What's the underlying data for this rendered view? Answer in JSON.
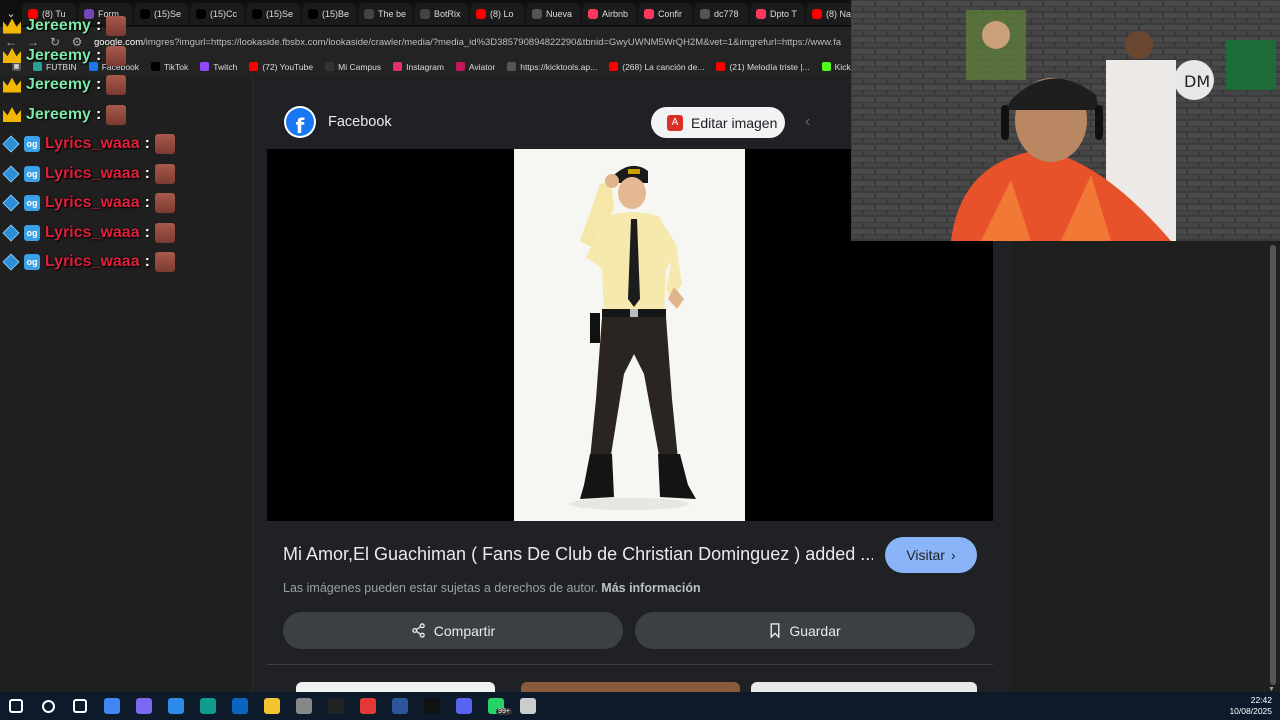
{
  "tabs": [
    {
      "label": "(8) Tu",
      "icon": "youtube-icon",
      "color": "#ff0000"
    },
    {
      "label": "Form",
      "icon": "forms-icon",
      "color": "#7248b9"
    },
    {
      "label": "(15)Se",
      "icon": "tiktok-icon",
      "color": "#000000"
    },
    {
      "label": "(15)Cc",
      "icon": "tiktok-icon",
      "color": "#000000"
    },
    {
      "label": "(15)Se",
      "icon": "tiktok-icon",
      "color": "#000000"
    },
    {
      "label": "(15)Be",
      "icon": "tiktok-icon",
      "color": "#000000"
    },
    {
      "label": "The be",
      "icon": "shield-icon",
      "color": "#444444"
    },
    {
      "label": "BotRix",
      "icon": "shield-icon",
      "color": "#444444"
    },
    {
      "label": "(8) Lo",
      "icon": "youtube-icon",
      "color": "#ff0000"
    },
    {
      "label": "Nueva",
      "icon": "openai-icon",
      "color": "#555555"
    },
    {
      "label": "Airbnb",
      "icon": "airbnb-icon",
      "color": "#ff385c"
    },
    {
      "label": "Confir",
      "icon": "airbnb-icon",
      "color": "#ff385c"
    },
    {
      "label": "dc778",
      "icon": "loading-icon",
      "color": "#555555"
    },
    {
      "label": "Dpto T",
      "icon": "airbnb-icon",
      "color": "#ff385c"
    },
    {
      "label": "(8) Na",
      "icon": "youtube-icon",
      "color": "#ff0000"
    }
  ],
  "url": {
    "domain": "google.com",
    "rest": "/imgres?imgurl=https://lookaside.fbsbx.com/lookaside/crawler/media/?media_id%3D385790894822290&tbnid=GwyUWNM5WrQH2M&vet=1&imgrefurl=https://www.fa"
  },
  "bookmarks": [
    {
      "label": "FUTBIN",
      "icon": "futbin-icon",
      "color": "#2aa198"
    },
    {
      "label": "Facebook",
      "icon": "facebook-icon",
      "color": "#1877f2"
    },
    {
      "label": "TikTok",
      "icon": "tiktok-icon",
      "color": "#000000"
    },
    {
      "label": "Twitch",
      "icon": "twitch-icon",
      "color": "#9146ff"
    },
    {
      "label": "(72) YouTube",
      "icon": "youtube-icon",
      "color": "#ff0000"
    },
    {
      "label": "Mi Campus",
      "icon": "campus-icon",
      "color": "#333333"
    },
    {
      "label": "Instagram",
      "icon": "instagram-icon",
      "color": "#e1306c"
    },
    {
      "label": "Aviator",
      "icon": "aviator-icon",
      "color": "#c2185b"
    },
    {
      "label": "https://kicktools.ap...",
      "icon": "globe-icon",
      "color": "#555555"
    },
    {
      "label": "(268) La canción de...",
      "icon": "youtube-icon",
      "color": "#ff0000"
    },
    {
      "label": "(21) Melodía triste |...",
      "icon": "youtube-icon",
      "color": "#ff0000"
    },
    {
      "label": "Kick",
      "icon": "kick-icon",
      "color": "#53fc18"
    }
  ],
  "chat": [
    {
      "user": "Jereemy",
      "badge": "crown",
      "color": "green"
    },
    {
      "user": "Jereemy",
      "badge": "crown",
      "color": "green"
    },
    {
      "user": "Jereemy",
      "badge": "crown",
      "color": "green"
    },
    {
      "user": "Jereemy",
      "badge": "crown",
      "color": "green"
    },
    {
      "user": "Lyrics_waaa",
      "badge": "cube",
      "color": "red"
    },
    {
      "user": "Lyrics_waaa",
      "badge": "cube",
      "color": "red"
    },
    {
      "user": "Lyrics_waaa",
      "badge": "cube",
      "color": "red"
    },
    {
      "user": "Lyrics_waaa",
      "badge": "cube",
      "color": "red"
    },
    {
      "user": "Lyrics_waaa",
      "badge": "cube",
      "color": "red"
    }
  ],
  "chat_colon": ":",
  "viewer": {
    "source_name": "Facebook",
    "edit_label": "Editar imagen",
    "caption": "Mi Amor,El Guachiman ( Fans De Club de Christian Dominguez ) added ...",
    "visit_label": "Visitar",
    "copyright_text": "Las imágenes pueden estar sujetas a derechos de autor.",
    "copyright_link": "Más información",
    "share_label": "Compartir",
    "save_label": "Guardar"
  },
  "taskbar": {
    "items": [
      {
        "icon": "windows-start-icon",
        "color": "#ffffff"
      },
      {
        "icon": "search-icon",
        "color": "#ffffff"
      },
      {
        "icon": "task-view-icon",
        "color": "#ffffff"
      },
      {
        "icon": "chrome-icon",
        "color": "#4285f4"
      },
      {
        "icon": "copilot-icon",
        "color": "#7b68ee"
      },
      {
        "icon": "store-icon",
        "color": "#2c8ae8"
      },
      {
        "icon": "edge-icon",
        "color": "#0f9d8f"
      },
      {
        "icon": "outlook-icon",
        "color": "#0a64c2"
      },
      {
        "icon": "folder-icon",
        "color": "#f4c430"
      },
      {
        "icon": "game-icon",
        "color": "#888888"
      },
      {
        "icon": "obs-icon",
        "color": "#222222"
      },
      {
        "icon": "app-red-icon",
        "color": "#e53935"
      },
      {
        "icon": "word-icon",
        "color": "#2b579a"
      },
      {
        "icon": "capcut-icon",
        "color": "#111111"
      },
      {
        "icon": "discord-icon",
        "color": "#5865f2"
      },
      {
        "icon": "whatsapp-icon",
        "color": "#25d366"
      },
      {
        "icon": "app-icon",
        "color": "#cccccc"
      }
    ],
    "whatsapp_badge": "99+",
    "time": "22:42",
    "date": "10/08/2025"
  }
}
